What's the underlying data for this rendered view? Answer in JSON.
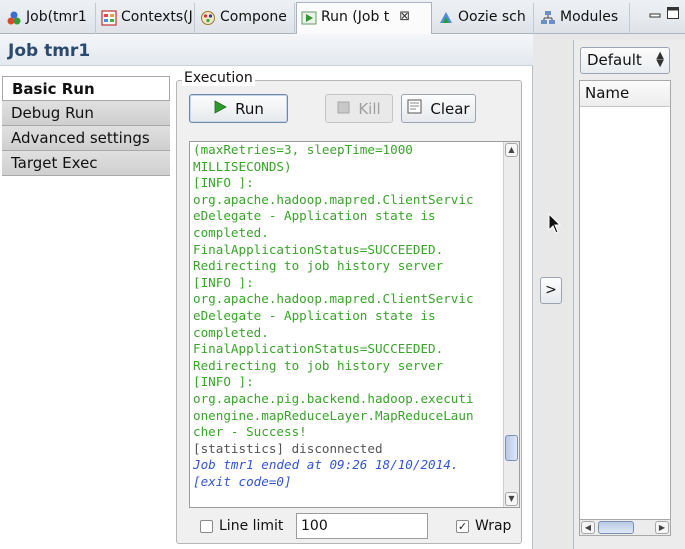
{
  "tabs": [
    {
      "label": "Job(tmr1",
      "icon": "job-icon",
      "active": false
    },
    {
      "label": "Contexts(J",
      "icon": "contexts-icon",
      "active": false
    },
    {
      "label": "Compone",
      "icon": "component-icon",
      "active": false
    },
    {
      "label": "Run (Job t",
      "icon": "run-icon",
      "active": true,
      "close": "⊠"
    },
    {
      "label": "Oozie sch",
      "icon": "oozie-icon",
      "active": false
    },
    {
      "label": "Modules",
      "icon": "modules-icon",
      "active": false
    }
  ],
  "job": {
    "title": "Job tmr1"
  },
  "sidebar": {
    "items": [
      {
        "label": "Basic Run",
        "active": true
      },
      {
        "label": "Debug Run",
        "active": false
      },
      {
        "label": "Advanced settings",
        "active": false
      },
      {
        "label": "Target Exec",
        "active": false
      }
    ]
  },
  "execution": {
    "legend": "Execution",
    "run_label": "Run",
    "kill_label": "Kill",
    "clear_label": "Clear"
  },
  "console": {
    "lines": [
      {
        "text": "(maxRetries=3, sleepTime=1000",
        "style": "green"
      },
      {
        "text": "MILLISECONDS)",
        "style": "green"
      },
      {
        "text": "[INFO ]:",
        "style": "green"
      },
      {
        "text": "org.apache.hadoop.mapred.ClientServic",
        "style": "green"
      },
      {
        "text": "eDelegate - Application state is",
        "style": "green"
      },
      {
        "text": "completed.",
        "style": "green"
      },
      {
        "text": "FinalApplicationStatus=SUCCEEDED.",
        "style": "green"
      },
      {
        "text": "Redirecting to job history server",
        "style": "green"
      },
      {
        "text": "[INFO ]:",
        "style": "green"
      },
      {
        "text": "org.apache.hadoop.mapred.ClientServic",
        "style": "green"
      },
      {
        "text": "eDelegate - Application state is",
        "style": "green"
      },
      {
        "text": "completed.",
        "style": "green"
      },
      {
        "text": "FinalApplicationStatus=SUCCEEDED.",
        "style": "green"
      },
      {
        "text": "Redirecting to job history server",
        "style": "green"
      },
      {
        "text": "[INFO ]:",
        "style": "green"
      },
      {
        "text": "org.apache.pig.backend.hadoop.executi",
        "style": "green"
      },
      {
        "text": "onengine.mapReduceLayer.MapReduceLaun",
        "style": "green"
      },
      {
        "text": "cher - Success!",
        "style": "green"
      },
      {
        "text": "[statistics] disconnected",
        "style": "gray"
      },
      {
        "text": "Job tmr1 ended at 09:26 18/10/2014.",
        "style": "blue"
      },
      {
        "text": "[exit code=0]",
        "style": "blue"
      }
    ],
    "scroll_position": 0.9
  },
  "options": {
    "line_limit_label": "Line limit",
    "line_limit_checked": false,
    "line_limit_value": "100",
    "wrap_label": "Wrap",
    "wrap_checked": true
  },
  "splitter": {
    "label": ">"
  },
  "right_panel": {
    "select_value": "Default",
    "column_header": "Name"
  },
  "colors": {
    "console_green": "#3aa32b",
    "console_blue": "#3455d1",
    "title_blue": "#2c4a6e",
    "run_green": "#2e9a2e"
  }
}
